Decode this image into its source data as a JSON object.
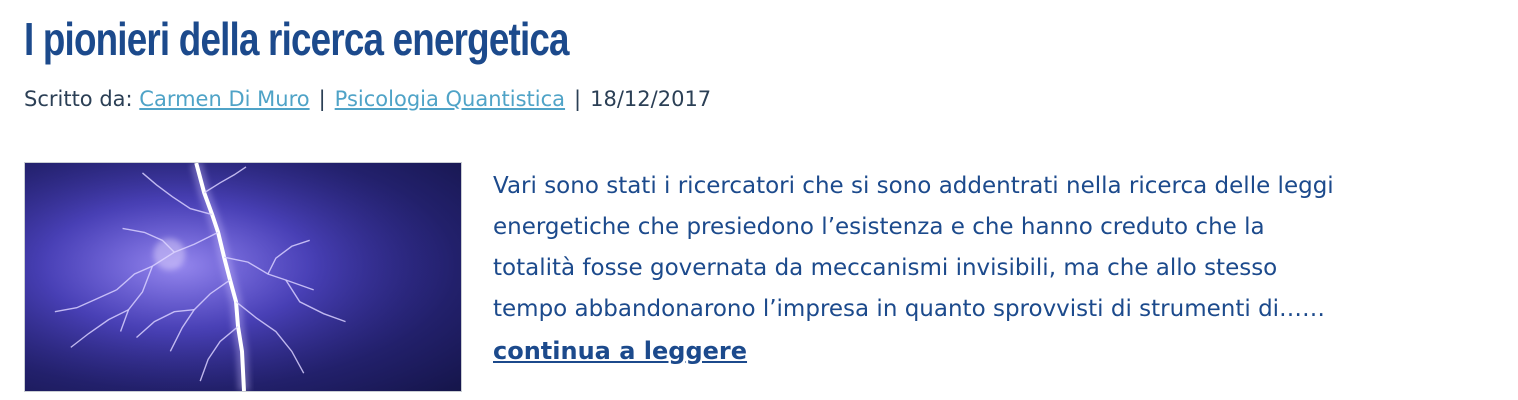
{
  "article": {
    "title": "I pionieri della ricerca energetica",
    "meta": {
      "prefix": "Scritto da: ",
      "author": "Carmen Di Muro",
      "separator": "|",
      "category": "Psicologia Quantistica",
      "date": "18/12/2017"
    },
    "thumbnail": {
      "alt": "lightning-storm-image"
    },
    "excerpt_lines": [
      "Vari sono stati i ricercatori che si sono addentrati nella ricerca delle leggi",
      "energetiche che presiedono l’esistenza e che hanno creduto che la",
      "totalità fosse governata da meccanismi invisibili, ma che allo stesso",
      "tempo abbandonarono l’impresa in quanto sprovvisti di strumenti di……"
    ],
    "read_more_label": "continua a leggere"
  },
  "colors": {
    "title": "#1c4a8c",
    "link": "#4fa3c7",
    "body_text": "#1c4a8c",
    "meta_text": "#2b3f55"
  }
}
